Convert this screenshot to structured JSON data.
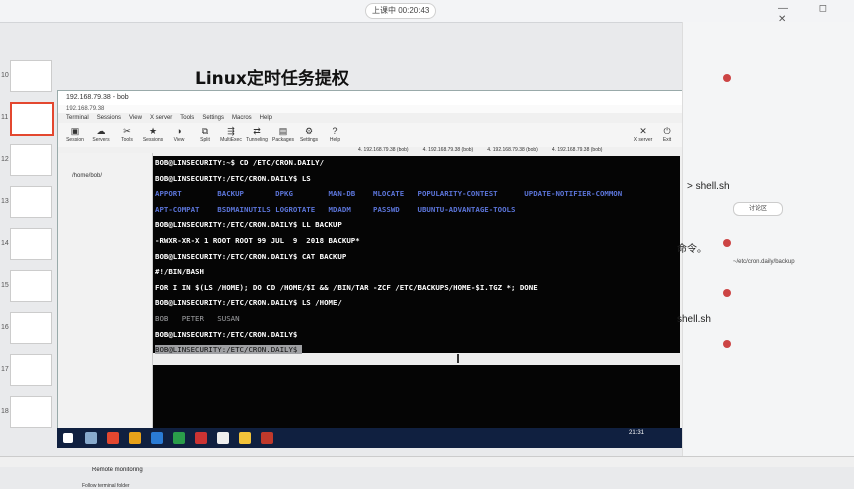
{
  "recorder": {
    "label": "上课中 00:20:43"
  },
  "window_controls": "— ◻ ✕",
  "slide_numbers": [
    "10",
    "11",
    "12",
    "13",
    "14",
    "15",
    "16",
    "17",
    "18"
  ],
  "slide": {
    "title": "Linux定时任务提权"
  },
  "xshell": {
    "title": "192.168.79.38 - bob",
    "address": "192.168.79.38",
    "menu": [
      "Terminal",
      "Sessions",
      "View",
      "X server",
      "Tools",
      "Settings",
      "Macros",
      "Help"
    ],
    "toolbar": [
      {
        "label": "Session",
        "icon": "session-icon"
      },
      {
        "label": "Servers",
        "icon": "servers-icon"
      },
      {
        "label": "Tools",
        "icon": "tools-icon"
      },
      {
        "label": "Sessions",
        "icon": "sessions-icon"
      },
      {
        "label": "View",
        "icon": "view-icon"
      },
      {
        "label": "Split",
        "icon": "split-icon"
      },
      {
        "label": "MultiExec",
        "icon": "multiexec-icon"
      },
      {
        "label": "Tunneling",
        "icon": "tunneling-icon"
      },
      {
        "label": "Packages",
        "icon": "packages-icon"
      },
      {
        "label": "Settings",
        "icon": "settings-icon"
      },
      {
        "label": "Help",
        "icon": "help-icon"
      },
      {
        "label": "X server",
        "icon": "x-icon"
      },
      {
        "label": "Exit",
        "icon": "exit-icon"
      }
    ],
    "sidebar": {
      "root": "/home/bob/",
      "remote_monitoring": "Remote monitoring",
      "follow": "Follow terminal folder"
    },
    "tabs": [
      "4. 192.168.79.38 (bob)",
      "4. 192.168.79.38 (bob)",
      "4. 192.168.79.38 (bob)",
      "4. 192.168.79.38 (bob)"
    ]
  },
  "terminal": {
    "lines": [
      {
        "text": "BOB@LINSECURITY:~$ CD /ETC/CRON.DAILY/",
        "cls": ""
      },
      {
        "text": "BOB@LINSECURITY:/ETC/CRON.DAILY$ LS",
        "cls": ""
      },
      {
        "text": "APPORT        BACKUP       DPKG        MAN-DB    MLOCATE   POPULARITY-CONTEST      UPDATE-NOTIFIER-COMMON",
        "cls": "dir"
      },
      {
        "text": "APT-COMPAT    BSDMAINUTILS LOGROTATE   MDADM     PASSWD    UBUNTU-ADVANTAGE-TOOLS",
        "cls": "dir"
      },
      {
        "text": "BOB@LINSECURITY:/ETC/CRON.DAILY$ LL BACKUP",
        "cls": ""
      },
      {
        "text": "-RWXR-XR-X 1 ROOT ROOT 99 JUL  9  2018 BACKUP*",
        "cls": ""
      },
      {
        "text": "BOB@LINSECURITY:/ETC/CRON.DAILY$ CAT BACKUP",
        "cls": ""
      },
      {
        "text": "#!/BIN/BASH",
        "cls": ""
      },
      {
        "text": "FOR I IN $(LS /HOME); DO CD /HOME/$I && /BIN/TAR -ZCF /ETC/BACKUPS/HOME-$I.TGZ *; DONE",
        "cls": ""
      },
      {
        "text": "BOB@LINSECURITY:/ETC/CRON.DAILY$ LS /HOME/",
        "cls": ""
      },
      {
        "text": "BOB   PETER   SUSAN",
        "cls": "dim"
      },
      {
        "text": "BOB@LINSECURITY:/ETC/CRON.DAILY$",
        "cls": ""
      },
      {
        "text": "BOB@LINSECURITY:/ETC/CRON.DAILY$ ",
        "cls": "hl"
      }
    ]
  },
  "right_panel": {
    "shell1": "> shell.sh",
    "chat_tab": "讨论区",
    "cmd": "命令。",
    "shell2": "shell.sh",
    "path": "~/etc/cron.daily/backup"
  },
  "taskbar": {
    "clock": "21:31"
  },
  "colors": {
    "terminal_bg": "#050505",
    "terminal_dir": "#5b74d8",
    "taskbar": "#102040",
    "accent": "#e3472f"
  }
}
